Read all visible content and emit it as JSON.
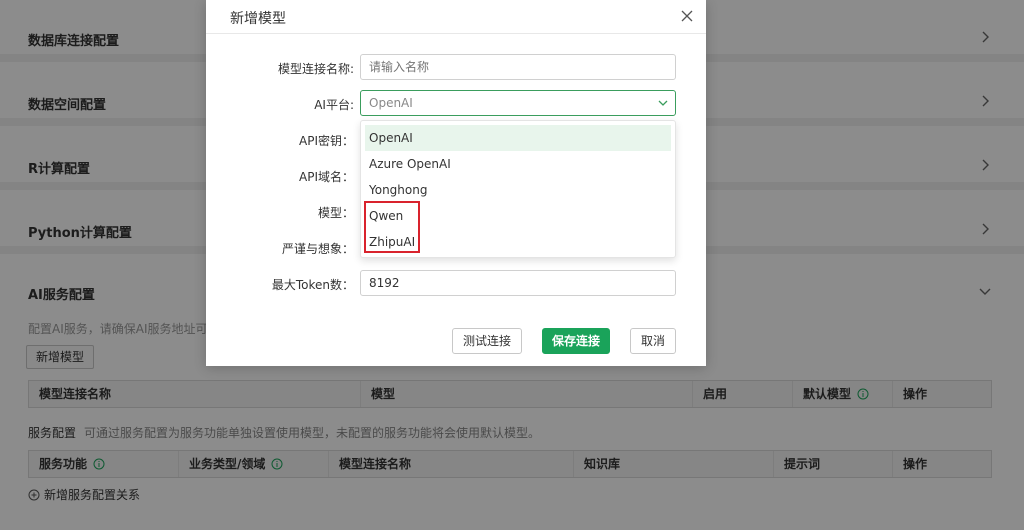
{
  "sections": [
    {
      "title": "数据库连接配置"
    },
    {
      "title": "数据空间配置"
    },
    {
      "title": "R计算配置"
    },
    {
      "title": "Python计算配置"
    }
  ],
  "ai_section": {
    "title": "AI服务配置",
    "description": "配置AI服务，请确保AI服务地址可",
    "add_model_button": "新增模型",
    "model_table": {
      "columns": [
        "模型连接名称",
        "模型",
        "启用",
        "默认模型",
        "操作"
      ]
    },
    "service_label": "服务配置",
    "service_description": "可通过服务配置为服务功能单独设置使用模型，未配置的服务功能将会使用默认模型。",
    "service_table": {
      "columns": [
        "服务功能",
        "业务类型/领域",
        "模型连接名称",
        "知识库",
        "提示词",
        "操作"
      ]
    },
    "add_service_link": "新增服务配置关系"
  },
  "modal": {
    "title": "新增模型",
    "fields": {
      "name_label": "模型连接名称:",
      "name_placeholder": "请输入名称",
      "platform_label": "AI平台:",
      "platform_value": "OpenAI",
      "api_key_label": "API密钥：",
      "api_domain_label": "API域名：",
      "model_label": "模型：",
      "rigor_label": "严谨与想象：",
      "max_token_label": "最大Token数：",
      "max_token_value": "8192"
    },
    "dropdown_options": [
      "OpenAI",
      "Azure OpenAI",
      "Yonghong",
      "Qwen",
      "ZhipuAI"
    ],
    "selected_option": "OpenAI",
    "buttons": {
      "test": "测试连接",
      "save": "保存连接",
      "cancel": "取消"
    }
  },
  "colors": {
    "primary": "#1aa35a",
    "highlight": "#d9232d",
    "focus_border": "#3a9d5d",
    "selected_bg": "#e8f5ec"
  }
}
